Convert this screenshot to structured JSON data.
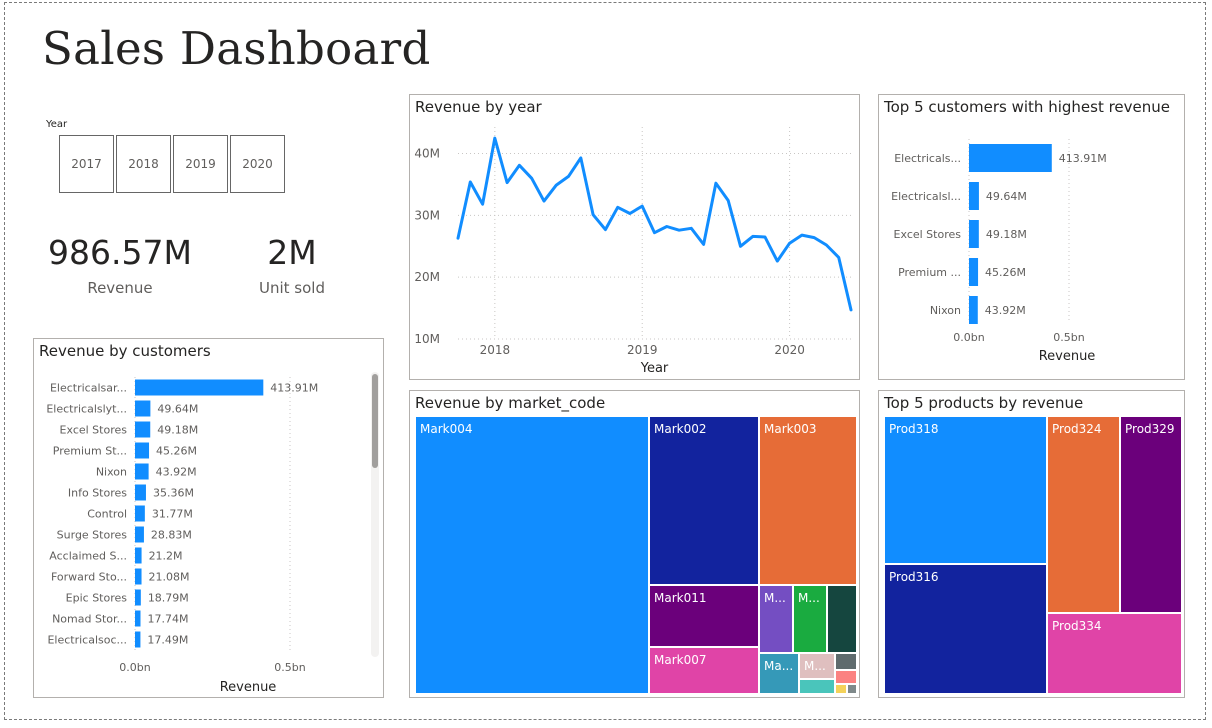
{
  "page": {
    "title": "Sales Dashboard"
  },
  "slicer": {
    "title": "Year",
    "options": [
      "2017",
      "2018",
      "2019",
      "2020"
    ]
  },
  "kpis": [
    {
      "value": "986.57M",
      "label": "Revenue"
    },
    {
      "value": "2M",
      "label": "Unit sold"
    }
  ],
  "colors": {
    "accent": "#118DFF",
    "market": {
      "Mark004": "#118DFF",
      "Mark002": "#12239E",
      "Mark003": "#E66C37",
      "Mark011": "#6B007B",
      "Mark007": "#E044A7"
    },
    "products": {
      "Prod318": "#118DFF",
      "Prod316": "#12239E",
      "Prod324": "#E66C37",
      "Prod329": "#6B007B",
      "Prod334": "#E044A7"
    }
  },
  "chart_data": [
    {
      "id": "revenue-by-year",
      "type": "line",
      "title": "Revenue by year",
      "xlabel": "Year",
      "ylabel": "",
      "x_ticks": [
        "2018",
        "2019",
        "2020"
      ],
      "y_ticks": [
        "10M",
        "20M",
        "30M",
        "40M"
      ],
      "ylim": [
        10,
        43
      ],
      "y_unit": "M",
      "x_period": "month",
      "x_start": "2017-10",
      "x_tick_months": [
        "2018-01",
        "2019-01",
        "2020-01"
      ],
      "values": [
        26.3,
        35.4,
        31.8,
        42.5,
        35.3,
        38.1,
        36.0,
        32.3,
        34.9,
        36.3,
        39.3,
        30.1,
        27.7,
        31.3,
        30.3,
        31.5,
        27.2,
        28.2,
        27.6,
        27.9,
        25.3,
        35.2,
        32.4,
        25.0,
        26.6,
        26.5,
        22.6,
        25.5,
        26.8,
        26.4,
        25.2,
        23.2,
        14.7
      ],
      "grid": true,
      "legend": "none"
    },
    {
      "id": "top5-customers",
      "type": "bar",
      "orientation": "horizontal",
      "title": "Top 5 customers with highest revenue",
      "xlabel": "Revenue",
      "categories": [
        "Electricals...",
        "Electricalsl...",
        "Excel Stores",
        "Premium ...",
        "Nixon"
      ],
      "values": [
        413.91,
        49.64,
        49.18,
        45.26,
        43.92
      ],
      "data_labels": [
        "413.91M",
        "49.64M",
        "49.18M",
        "45.26M",
        "43.92M"
      ],
      "x_ticks": [
        "0.0bn",
        "0.5bn"
      ],
      "xlim": [
        0,
        1000
      ]
    },
    {
      "id": "revenue-by-customers",
      "type": "bar",
      "orientation": "horizontal",
      "title": "Revenue by customers",
      "xlabel": "Revenue",
      "categories": [
        "Electricalsar...",
        "Electricalslyt...",
        "Excel Stores",
        "Premium St...",
        "Nixon",
        "Info Stores",
        "Control",
        "Surge Stores",
        "Acclaimed S...",
        "Forward Sto...",
        "Epic Stores",
        "Nomad Stor...",
        "Electricalsoc..."
      ],
      "values": [
        413.91,
        49.64,
        49.18,
        45.26,
        43.92,
        35.36,
        31.77,
        28.83,
        21.2,
        21.08,
        18.79,
        17.74,
        17.49
      ],
      "data_labels": [
        "413.91M",
        "49.64M",
        "49.18M",
        "45.26M",
        "43.92M",
        "35.36M",
        "31.77M",
        "28.83M",
        "21.2M",
        "21.08M",
        "18.79M",
        "17.74M",
        "17.49M"
      ],
      "x_ticks": [
        "0.0bn",
        "0.5bn"
      ],
      "xlim": [
        0,
        600
      ]
    },
    {
      "id": "revenue-by-market-code",
      "type": "treemap",
      "title": "Revenue by market_code",
      "labels": [
        "Mark004",
        "Mark002",
        "Mark003",
        "Mark011",
        "Mark007",
        "M...",
        "M...",
        "Ma...",
        "M..."
      ]
    },
    {
      "id": "top5-products",
      "type": "treemap",
      "title": "Top 5 products by revenue",
      "labels": [
        "Prod318",
        "Prod316",
        "Prod324",
        "Prod329",
        "Prod334"
      ]
    }
  ]
}
